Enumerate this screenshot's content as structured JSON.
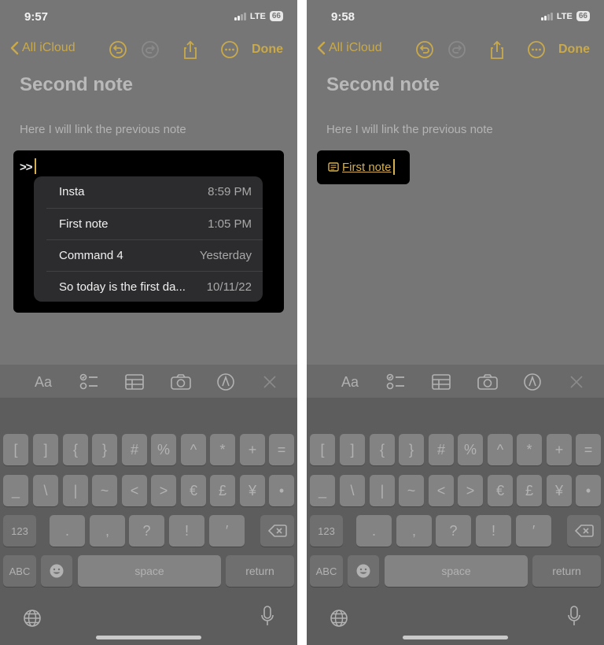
{
  "colors": {
    "accent": "#c9a94a",
    "link": "#d6b04c",
    "screen_dim": "#767676",
    "popup": "#2c2c2e"
  },
  "screens": [
    {
      "status": {
        "time": "9:57",
        "network": "LTE",
        "battery": "66"
      },
      "nav": {
        "back_label": "All iCloud",
        "done_label": "Done",
        "icons": [
          "chevron-left-icon",
          "undo-icon",
          "redo-icon",
          "share-icon",
          "more-icon"
        ]
      },
      "note": {
        "title": "Second note",
        "body": "Here I will link the previous note",
        "typed": ">>"
      },
      "suggestions": [
        {
          "name": "Insta",
          "time": "8:59 PM"
        },
        {
          "name": "First note",
          "time": "1:05 PM"
        },
        {
          "name": "Command 4",
          "time": "Yesterday"
        },
        {
          "name": "So today is the first da...",
          "time": "10/11/22"
        }
      ]
    },
    {
      "status": {
        "time": "9:58",
        "network": "LTE",
        "battery": "66"
      },
      "nav": {
        "back_label": "All iCloud",
        "done_label": "Done",
        "icons": [
          "chevron-left-icon",
          "undo-icon",
          "redo-icon",
          "share-icon",
          "more-icon"
        ]
      },
      "note": {
        "title": "Second note",
        "body": "Here I will link the previous note",
        "link_text": "First note"
      }
    }
  ],
  "toolbar": {
    "format_label": "Aa",
    "icons": [
      "format-icon",
      "checklist-icon",
      "table-icon",
      "camera-icon",
      "markup-icon",
      "close-icon"
    ]
  },
  "keyboard": {
    "row1": [
      "[",
      "]",
      "{",
      "}",
      "#",
      "%",
      "^",
      "*",
      "+",
      "="
    ],
    "row2": [
      "_",
      "\\",
      "|",
      "~",
      "<",
      ">",
      "€",
      "£",
      "¥",
      "•"
    ],
    "row3_mode": "123",
    "row3": [
      ".",
      ",",
      "?",
      "!",
      "′"
    ],
    "abc_label": "ABC",
    "space_label": "space",
    "return_label": "return",
    "icons": [
      "backspace-icon",
      "emoji-icon",
      "globe-icon",
      "microphone-icon"
    ]
  }
}
